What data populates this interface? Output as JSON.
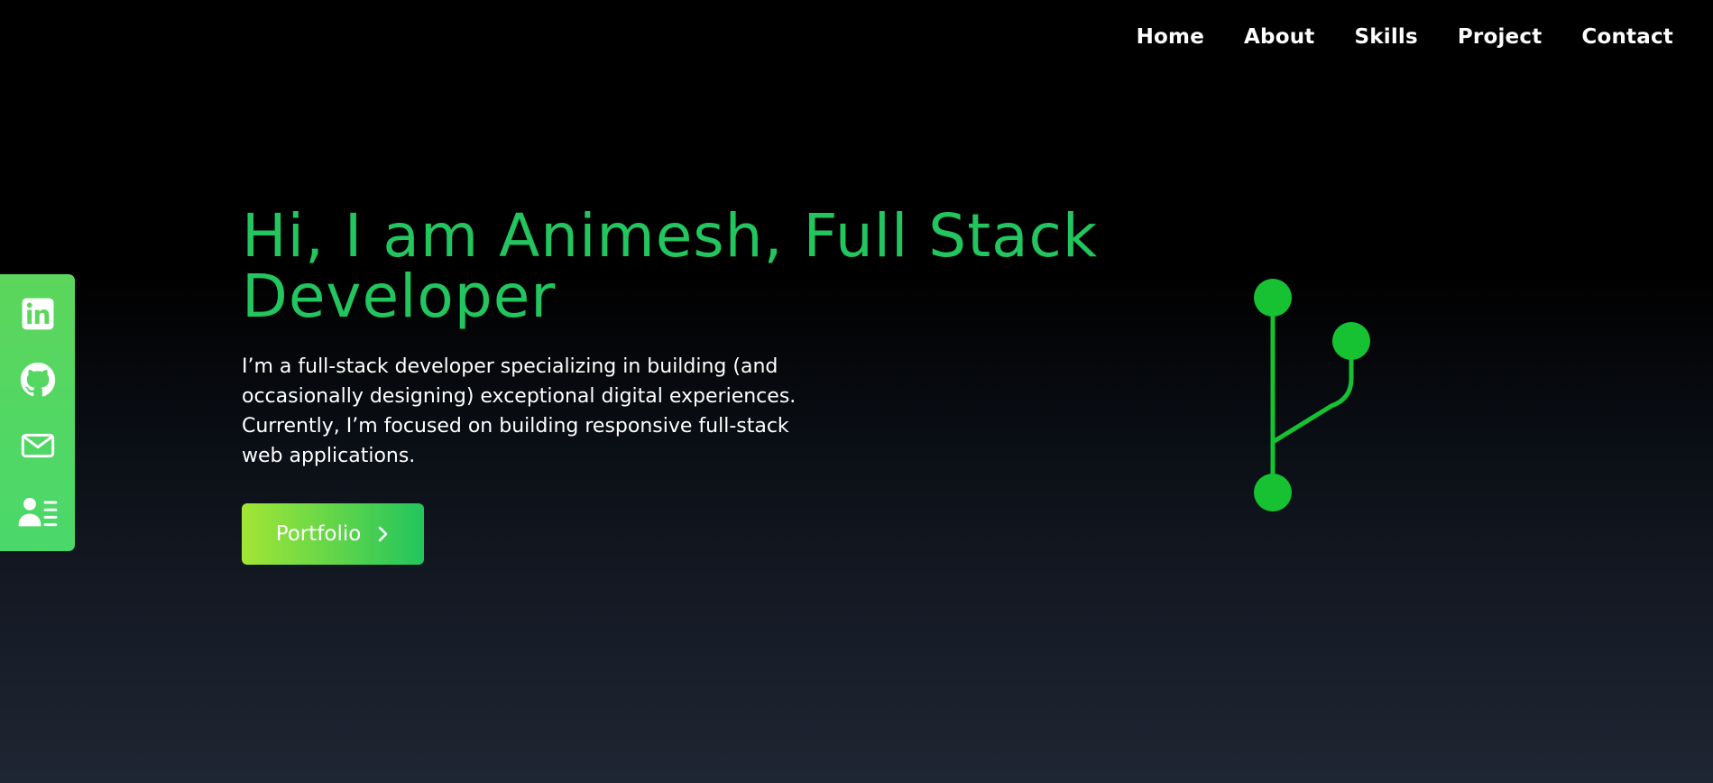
{
  "nav": {
    "items": [
      {
        "label": "Home"
      },
      {
        "label": "About"
      },
      {
        "label": "Skills"
      },
      {
        "label": "Project"
      },
      {
        "label": "Contact"
      }
    ]
  },
  "social": {
    "icons": [
      "linkedin-icon",
      "github-icon",
      "mail-icon",
      "contact-card-icon"
    ]
  },
  "hero": {
    "title": "Hi, I am Animesh, Full Stack Developer",
    "description": "I’m a full-stack developer specializing in building (and occasionally designing) exceptional digital experiences. Currently, I’m focused on building responsive full-stack web applications.",
    "button_label": "Portfolio"
  },
  "colors": {
    "accent": "#22c55e",
    "sidebar": "#5cd65c",
    "button_start": "#a3e635",
    "button_end": "#22c55e",
    "git_art": "#16c232"
  }
}
